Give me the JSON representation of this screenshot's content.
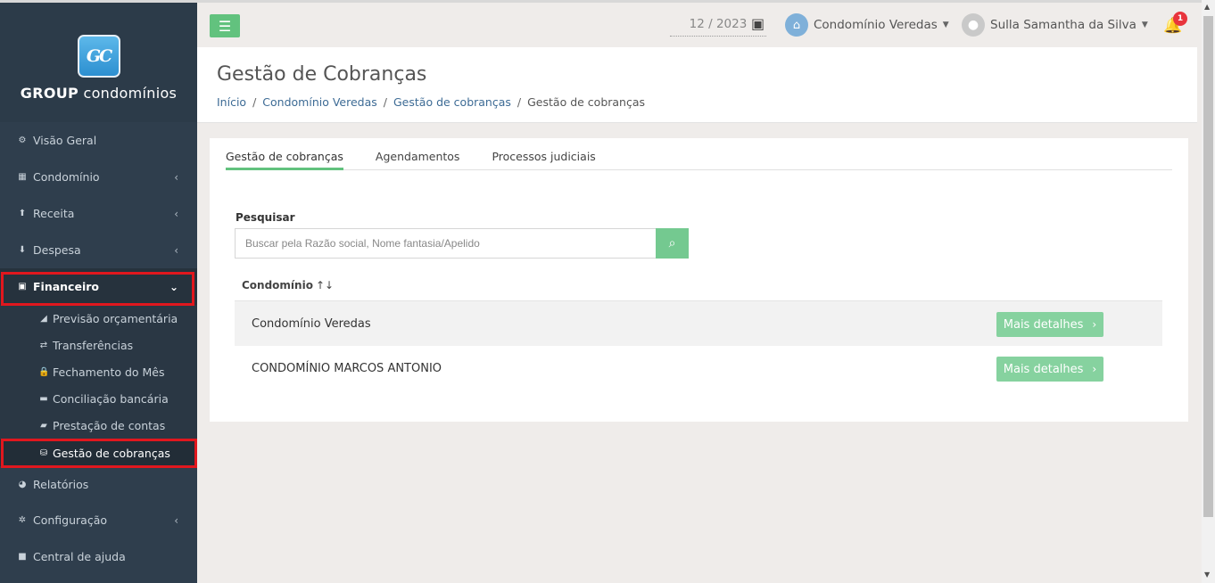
{
  "brand": {
    "logo_text": "GC",
    "name_bold": "GROUP",
    "name_light": "condomínios"
  },
  "sidebar": {
    "items": [
      {
        "label": "Visão Geral",
        "icon": "dashboard-icon",
        "glyph": "⚙"
      },
      {
        "label": "Condomínio",
        "icon": "building-icon",
        "glyph": "▦"
      },
      {
        "label": "Receita",
        "icon": "arrow-up-circle-icon",
        "glyph": "⬆"
      },
      {
        "label": "Despesa",
        "icon": "arrow-down-circle-icon",
        "glyph": "⬇"
      },
      {
        "label": "Financeiro",
        "icon": "calculator-icon",
        "glyph": "▣"
      },
      {
        "label": "Relatórios",
        "icon": "pie-chart-icon",
        "glyph": "◕"
      },
      {
        "label": "Configuração",
        "icon": "cog-icon",
        "glyph": "✲"
      },
      {
        "label": "Central de ajuda",
        "icon": "book-icon",
        "glyph": "■"
      }
    ],
    "financeiro_sub": [
      {
        "label": "Previsão orçamentária",
        "icon": "area-chart-icon",
        "glyph": "◢"
      },
      {
        "label": "Transferências",
        "icon": "exchange-icon",
        "glyph": "⇄"
      },
      {
        "label": "Fechamento do Mês",
        "icon": "lock-icon",
        "glyph": "🔒"
      },
      {
        "label": "Conciliação bancária",
        "icon": "credit-card-icon",
        "glyph": "▬"
      },
      {
        "label": "Prestação de contas",
        "icon": "folder-open-icon",
        "glyph": "▰"
      },
      {
        "label": "Gestão de cobranças",
        "icon": "coins-icon",
        "glyph": "⛁"
      }
    ]
  },
  "topbar": {
    "period": "12 / 2023",
    "condo": "Condomínio Veredas",
    "user": "Sulla Samantha da Silva",
    "notifications": "1"
  },
  "header": {
    "title": "Gestão de Cobranças",
    "breadcrumb": [
      "Início",
      "Condomínio Veredas",
      "Gestão de cobranças",
      "Gestão de cobranças"
    ]
  },
  "tabs": [
    "Gestão de cobranças",
    "Agendamentos",
    "Processos judiciais"
  ],
  "search": {
    "label": "Pesquisar",
    "placeholder": "Buscar pela Razão social, Nome fantasia/Apelido",
    "value": ""
  },
  "table": {
    "column": "Condomínio",
    "sort_glyph": "↑↓",
    "rows": [
      {
        "name": "Condomínio Veredas",
        "action": "Mais detalhes"
      },
      {
        "name": "CONDOMÍNIO MARCOS ANTONIO",
        "action": "Mais detalhes"
      }
    ]
  },
  "colors": {
    "accent": "#62c27e",
    "sidebar": "#2f3e4d",
    "highlight": "#e1171e",
    "badge": "#e8343d"
  }
}
